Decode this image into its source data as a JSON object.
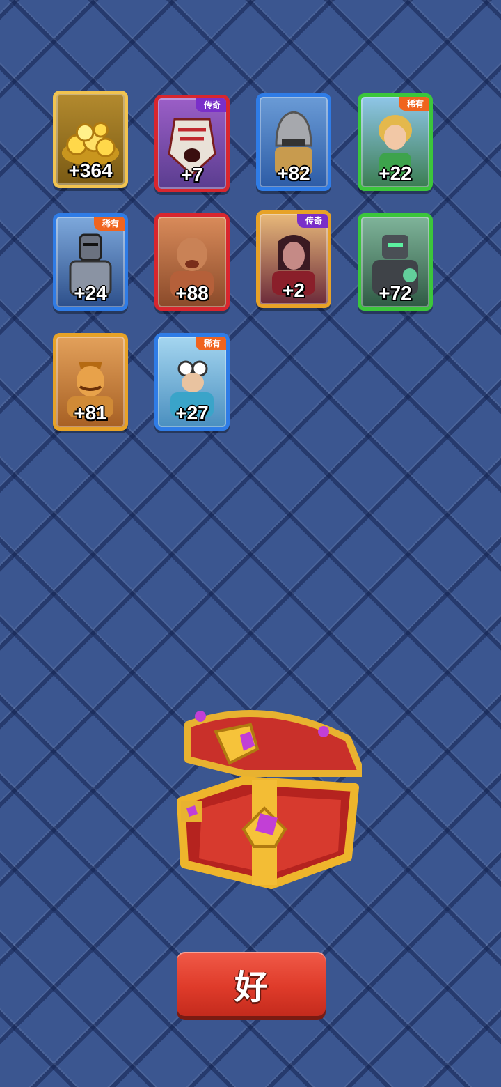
{
  "rewards": [
    {
      "amount": "+364",
      "tag": "",
      "icon": "gold-coins-icon"
    },
    {
      "amount": "+7",
      "tag": "传奇",
      "icon": "masked-warrior-portrait"
    },
    {
      "amount": "+82",
      "tag": "",
      "icon": "helmet-soldier-portrait"
    },
    {
      "amount": "+22",
      "tag": "稀有",
      "icon": "blonde-ranger-portrait"
    },
    {
      "amount": "+24",
      "tag": "稀有",
      "icon": "armored-knight-portrait"
    },
    {
      "amount": "+88",
      "tag": "",
      "icon": "brute-fighter-portrait"
    },
    {
      "amount": "+2",
      "tag": "传奇",
      "icon": "vampire-lord-portrait"
    },
    {
      "amount": "+72",
      "tag": "",
      "icon": "stone-golem-portrait"
    },
    {
      "amount": "+81",
      "tag": "",
      "icon": "genie-portrait"
    },
    {
      "amount": "+27",
      "tag": "稀有",
      "icon": "goggles-engineer-portrait"
    }
  ],
  "chest": {
    "icon": "treasure-chest-icon"
  },
  "confirm_button": {
    "label": "好"
  },
  "colors": {
    "background": "#3b5690",
    "legendary_tag": "#7a2fc9",
    "rare_tag": "#f0641e",
    "button": "#df3b2a"
  }
}
